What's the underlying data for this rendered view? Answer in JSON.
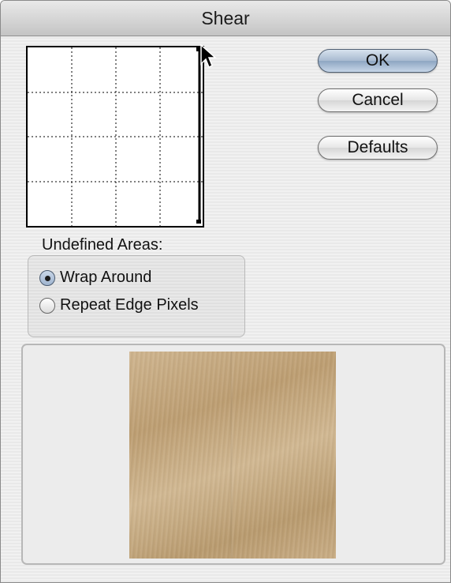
{
  "window": {
    "title": "Shear"
  },
  "buttons": {
    "ok": "OK",
    "cancel": "Cancel",
    "defaults": "Defaults"
  },
  "undefined_areas": {
    "label": "Undefined Areas:",
    "options": [
      {
        "label": "Wrap Around",
        "selected": true
      },
      {
        "label": "Repeat Edge Pixels",
        "selected": false
      }
    ]
  },
  "icons": {
    "cursor": "arrow-cursor-icon"
  },
  "colors": {
    "accent": "#9fb4cf",
    "preview_texture": "#c7aa82"
  }
}
